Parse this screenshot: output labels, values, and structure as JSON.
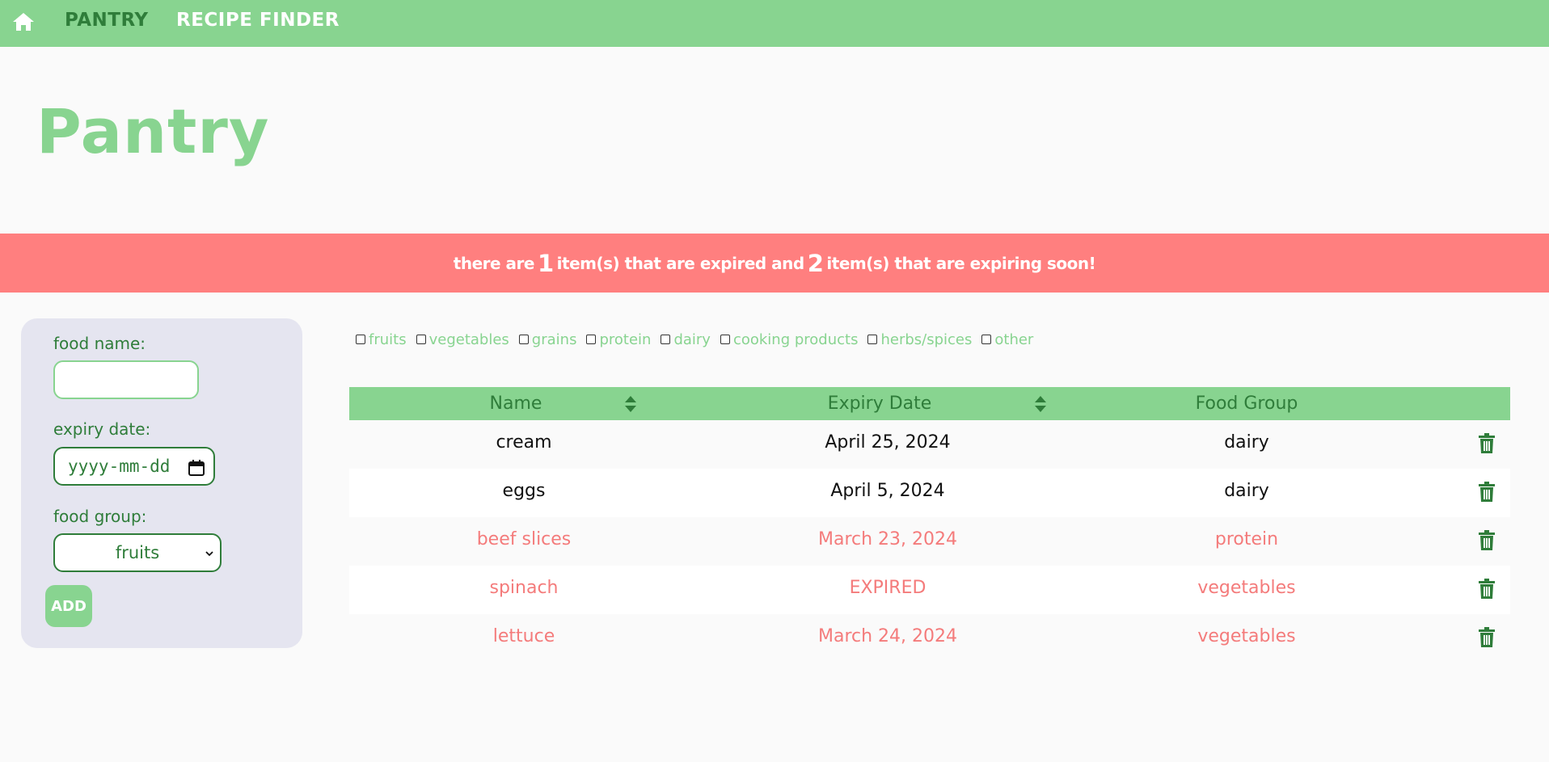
{
  "nav": {
    "home_icon": "home-icon",
    "pantry_label": "PANTRY",
    "recipe_label": "RECIPE FINDER"
  },
  "page": {
    "title": "Pantry"
  },
  "banner": {
    "prefix": "there are",
    "expired_count": "1",
    "middle": "item(s) that are expired and",
    "expiring_count": "2",
    "suffix": "item(s) that are expiring soon!"
  },
  "form": {
    "name_label": "food name:",
    "name_value": "",
    "date_label": "expiry date:",
    "date_placeholder": "yyyy-mm-dd",
    "group_label": "food group:",
    "group_selected": "fruits",
    "add_label": "ADD"
  },
  "filters": [
    "fruits",
    "vegetables",
    "grains",
    "protein",
    "dairy",
    "cooking products",
    "herbs/spices",
    "other"
  ],
  "table": {
    "headers": {
      "name": "Name",
      "expiry": "Expiry Date",
      "group": "Food Group"
    },
    "rows": [
      {
        "name": "cream",
        "expiry": "April 25, 2024",
        "group": "dairy",
        "status": "ok"
      },
      {
        "name": "eggs",
        "expiry": "April 5, 2024",
        "group": "dairy",
        "status": "ok"
      },
      {
        "name": "beef slices",
        "expiry": "March 23, 2024",
        "group": "protein",
        "status": "warn"
      },
      {
        "name": "spinach",
        "expiry": "EXPIRED",
        "group": "vegetables",
        "status": "warn"
      },
      {
        "name": "lettuce",
        "expiry": "March 24, 2024",
        "group": "vegetables",
        "status": "warn"
      }
    ]
  },
  "colors": {
    "accent_green": "#88d490",
    "dark_green": "#2f7d3a",
    "alert_red": "#ff7f7f",
    "panel_bg": "#e5e5f0"
  }
}
